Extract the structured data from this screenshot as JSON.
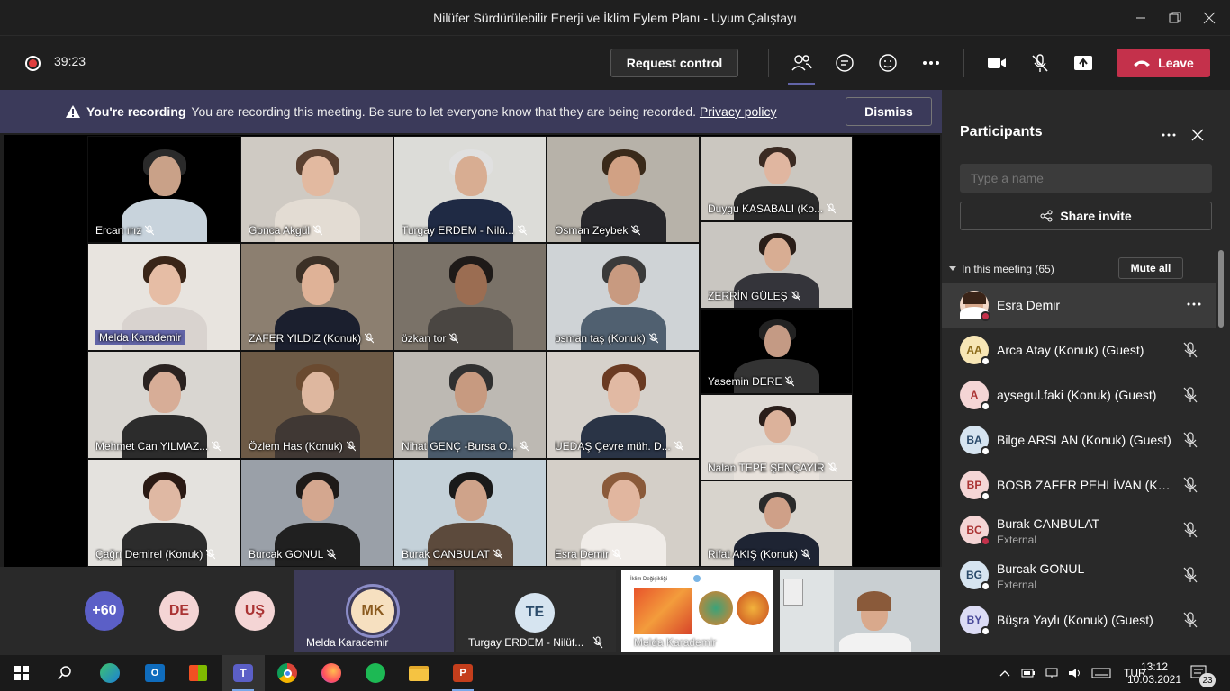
{
  "window": {
    "title": "Nilüfer Sürdürülebilir Enerji ve İklim Eylem Planı - Uyum Çalıştayı"
  },
  "toolbar": {
    "timer": "39:23",
    "request_control": "Request control",
    "leave": "Leave"
  },
  "banner": {
    "heading": "You're recording",
    "message": "You are recording this meeting. Be sure to let everyone know that they are being recorded.",
    "link": "Privacy policy",
    "dismiss": "Dismiss"
  },
  "tiles": [
    "Ercan ırız",
    "Gonca Akgül",
    "Turgay ERDEM - Nilü...",
    "Osman Zeybek",
    "Duygu KASABALI (Ko...",
    "Melda Karademir",
    "ZAFER YILDIZ (Konuk)",
    "özkan tor",
    "osman taş (Konuk)",
    "ZERRİN GÜLEŞ",
    "Yasemin DERE",
    "Mehmet Can YILMAZ...",
    "Özlem Has (Konuk)",
    "Nihat GENÇ -Bursa O...",
    "UEDAŞ Çevre müh. D...",
    "Nalan TEPE ŞENÇAYIR",
    "Çağrı Demirel (Konuk)",
    "Burcak GONUL",
    "Burak CANBULAT",
    "Esra Demir",
    "Rifat AKIŞ (Konuk)"
  ],
  "bottom": {
    "overflow": "+60",
    "av1": "DE",
    "av2": "UŞ",
    "mk_initials": "MK",
    "mk_name": "Melda Karademir",
    "te_initials": "TE",
    "te_name": "Turgay ERDEM - Nilüf...",
    "share_name": "Melda Karademir"
  },
  "panel": {
    "title": "Participants",
    "search_placeholder": "Type a name",
    "share_invite": "Share invite",
    "in_meeting": "In this meeting (65)",
    "mute_all": "Mute all",
    "participants": [
      {
        "initials": "",
        "name": "Esra Demir",
        "sub": ""
      },
      {
        "initials": "AA",
        "name": "Arca Atay (Konuk) (Guest)",
        "sub": ""
      },
      {
        "initials": "A",
        "name": "aysegul.faki (Konuk) (Guest)",
        "sub": ""
      },
      {
        "initials": "BA",
        "name": "Bilge ARSLAN (Konuk) (Guest)",
        "sub": ""
      },
      {
        "initials": "BP",
        "name": "BOSB ZAFER PEHLİVAN (Konu...",
        "sub": ""
      },
      {
        "initials": "BC",
        "name": "Burak CANBULAT",
        "sub": "External"
      },
      {
        "initials": "BG",
        "name": "Burcak GONUL",
        "sub": "External"
      },
      {
        "initials": "BY",
        "name": "Büşra Yaylı (Konuk) (Guest)",
        "sub": ""
      }
    ]
  },
  "taskbar": {
    "lang": "TUR",
    "time": "13:12",
    "date": "10.03.2021",
    "notif_count": "23"
  },
  "colors": {
    "accent": "#6264a7",
    "leave": "#c4314b",
    "banner": "#3b3a5a"
  }
}
